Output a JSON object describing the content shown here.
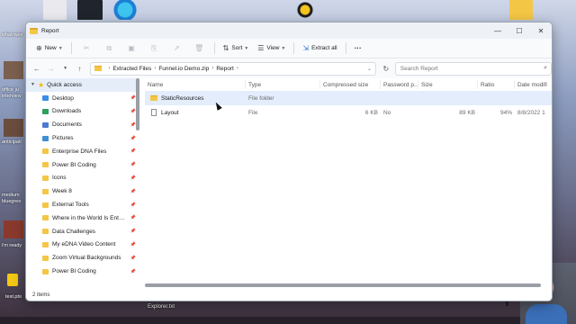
{
  "desktop": {
    "left_labels": [
      "what-wee",
      "office ju",
      "interview",
      "anticipati",
      "medium",
      "bluegree",
      "i'm ready",
      "test.pbi"
    ],
    "bottom_label": "Explorer.txt"
  },
  "window": {
    "title": "Report",
    "controls": {
      "minimize": "—",
      "maximize": "☐",
      "close": "✕"
    }
  },
  "command_bar": {
    "new_label": "New",
    "sort_label": "Sort",
    "view_label": "View",
    "extract_all_label": "Extract all",
    "more_label": "···"
  },
  "address_bar": {
    "breadcrumbs": [
      "Extracted Files",
      "Funnel.io Demo.zip",
      "Report"
    ],
    "search_placeholder": "Search Report"
  },
  "navigation_pane": {
    "header": "Quick access",
    "items": [
      {
        "label": "Desktop",
        "icon": "desktop-folder-icon",
        "color": "#3a8ee6"
      },
      {
        "label": "Downloads",
        "icon": "downloads-folder-icon",
        "color": "#2f9e5e"
      },
      {
        "label": "Documents",
        "icon": "documents-folder-icon",
        "color": "#4b7bd1"
      },
      {
        "label": "Pictures",
        "icon": "pictures-folder-icon",
        "color": "#3f8fd6"
      },
      {
        "label": "Enterprise DNA Files",
        "icon": "folder-icon",
        "color": "#f3c646"
      },
      {
        "label": "Power BI Coding",
        "icon": "folder-icon",
        "color": "#f3c646"
      },
      {
        "label": "Icons",
        "icon": "folder-icon",
        "color": "#f3c646"
      },
      {
        "label": "Week 8",
        "icon": "folder-icon",
        "color": "#f3c646"
      },
      {
        "label": "External Tools",
        "icon": "folder-icon",
        "color": "#f3c646"
      },
      {
        "label": "Where in the World Is Enterprise DNA",
        "icon": "folder-icon",
        "color": "#f3c646"
      },
      {
        "label": "Data Challenges",
        "icon": "folder-icon",
        "color": "#f3c646"
      },
      {
        "label": "My eDNA Video Content",
        "icon": "folder-icon",
        "color": "#f3c646"
      },
      {
        "label": "Zoom Virtual Backgrounds",
        "icon": "folder-icon",
        "color": "#f3c646"
      },
      {
        "label": "Power BI Coding",
        "icon": "folder-icon",
        "color": "#f3c646"
      }
    ]
  },
  "file_list": {
    "columns": [
      "Name",
      "Type",
      "Compressed size",
      "Password p...",
      "Size",
      "Ratio",
      "Date modifi"
    ],
    "rows": [
      {
        "name": "StaticResources",
        "type": "File folder",
        "compressed": "",
        "password": "",
        "size": "",
        "ratio": "",
        "date": "",
        "kind": "folder",
        "selected": true
      },
      {
        "name": "Layout",
        "type": "File",
        "compressed": "6 KB",
        "password": "No",
        "size": "89 KB",
        "ratio": "94%",
        "date": "8/8/2022 1",
        "kind": "file",
        "selected": false
      }
    ]
  },
  "status_bar": {
    "item_count": "2 items"
  }
}
